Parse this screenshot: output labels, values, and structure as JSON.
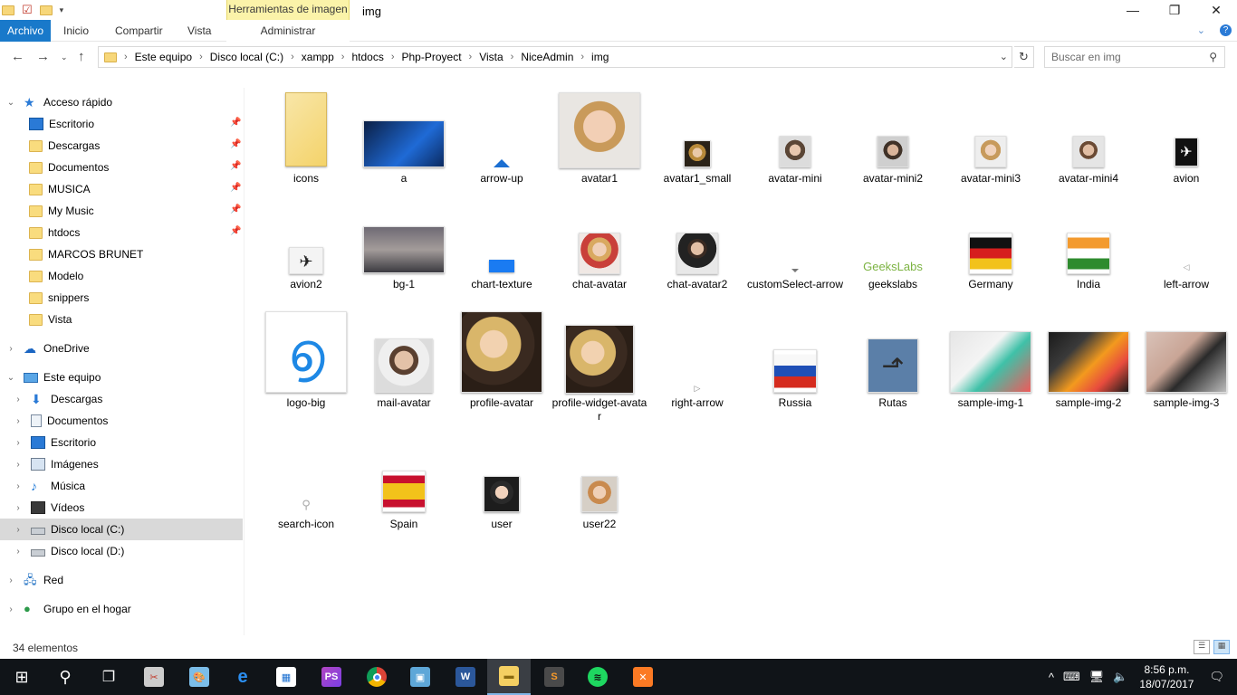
{
  "window": {
    "title": "img",
    "context_tab": "Herramientas de imagen"
  },
  "ribbon": {
    "tabs": [
      "Archivo",
      "Inicio",
      "Compartir",
      "Vista"
    ],
    "context_tab": "Administrar"
  },
  "address": {
    "crumbs": [
      "Este equipo",
      "Disco local (C:)",
      "xampp",
      "htdocs",
      "Php-Proyect",
      "Vista",
      "NiceAdmin",
      "img"
    ]
  },
  "search": {
    "placeholder": "Buscar en img"
  },
  "navpane": {
    "quick_access": "Acceso rápido",
    "quick_items": [
      "Escritorio",
      "Descargas",
      "Documentos",
      "MUSICA",
      "My Music",
      "htdocs",
      "MARCOS BRUNET",
      "Modelo",
      "snippers",
      "Vista"
    ],
    "onedrive": "OneDrive",
    "this_pc": "Este equipo",
    "pc_items": [
      "Descargas",
      "Documentos",
      "Escritorio",
      "Imágenes",
      "Música",
      "Vídeos",
      "Disco local (C:)",
      "Disco local (D:)"
    ],
    "network": "Red",
    "homegroup": "Grupo en el hogar"
  },
  "files": [
    "icons",
    "a",
    "arrow-up",
    "avatar1",
    "avatar1_small",
    "avatar-mini",
    "avatar-mini2",
    "avatar-mini3",
    "avatar-mini4",
    "avion",
    "avion2",
    "bg-1",
    "chart-texture",
    "chat-avatar",
    "chat-avatar2",
    "customSelect-arrow",
    "geekslabs",
    "Germany",
    "India",
    "left-arrow",
    "logo-big",
    "mail-avatar",
    "profile-avatar",
    "profile-widget-avatar",
    "right-arrow",
    "Russia",
    "Rutas",
    "sample-img-1",
    "sample-img-2",
    "sample-img-3",
    "search-icon",
    "Spain",
    "user",
    "user22"
  ],
  "status": {
    "count": "34 elementos"
  },
  "taskbar": {
    "time": "8:56 p.m.",
    "date": "18/07/2017"
  }
}
